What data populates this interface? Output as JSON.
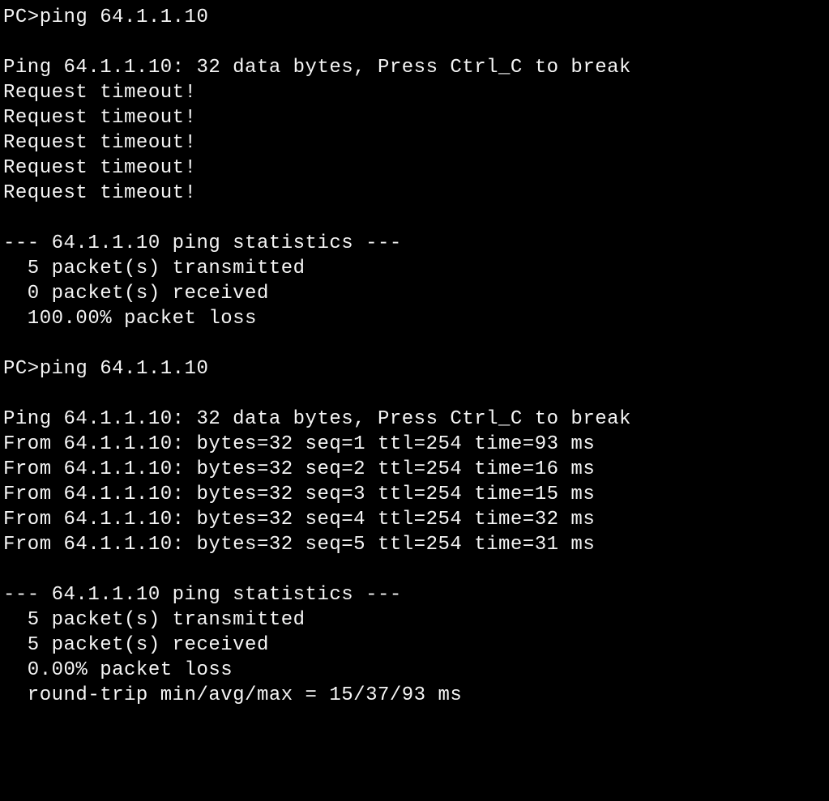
{
  "terminal": {
    "prompt": "PC>",
    "sessions": [
      {
        "command": "ping 64.1.1.10",
        "header": "Ping 64.1.1.10: 32 data bytes, Press Ctrl_C to break",
        "replies": [
          "Request timeout!",
          "Request timeout!",
          "Request timeout!",
          "Request timeout!",
          "Request timeout!"
        ],
        "stats": {
          "title": "--- 64.1.1.10 ping statistics ---",
          "lines": [
            "  5 packet(s) transmitted",
            "  0 packet(s) received",
            "  100.00% packet loss"
          ]
        }
      },
      {
        "command": "ping 64.1.1.10",
        "header": "Ping 64.1.1.10: 32 data bytes, Press Ctrl_C to break",
        "replies": [
          "From 64.1.1.10: bytes=32 seq=1 ttl=254 time=93 ms",
          "From 64.1.1.10: bytes=32 seq=2 ttl=254 time=16 ms",
          "From 64.1.1.10: bytes=32 seq=3 ttl=254 time=15 ms",
          "From 64.1.1.10: bytes=32 seq=4 ttl=254 time=32 ms",
          "From 64.1.1.10: bytes=32 seq=5 ttl=254 time=31 ms"
        ],
        "stats": {
          "title": "--- 64.1.1.10 ping statistics ---",
          "lines": [
            "  5 packet(s) transmitted",
            "  5 packet(s) received",
            "  0.00% packet loss",
            "  round-trip min/avg/max = 15/37/93 ms"
          ]
        }
      }
    ]
  }
}
